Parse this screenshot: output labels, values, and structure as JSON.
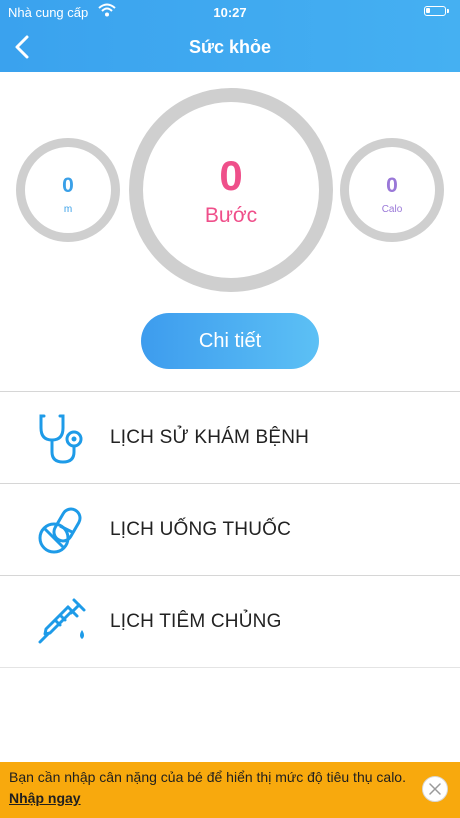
{
  "status_bar": {
    "carrier": "Nhà cung cấp",
    "time": "10:27"
  },
  "header": {
    "title": "Sức khỏe",
    "back_icon": "chevron-left-icon"
  },
  "stats": {
    "distance": {
      "value": "0",
      "unit": "m",
      "color": "#3aa0e8"
    },
    "steps": {
      "value": "0",
      "unit": "Bước",
      "color": "#ef4f8a"
    },
    "calories": {
      "value": "0",
      "unit": "Calo",
      "color": "#9a78d8"
    }
  },
  "detail_button": {
    "label": "Chi tiết"
  },
  "menu": {
    "items": [
      {
        "label": "LỊCH SỬ KHÁM BỆNH",
        "icon": "stethoscope-icon"
      },
      {
        "label": "LỊCH UỐNG THUỐC",
        "icon": "pill-icon"
      },
      {
        "label": "LỊCH TIÊM CHỦNG",
        "icon": "syringe-icon"
      }
    ]
  },
  "banner": {
    "message": "Bạn cần nhập cân nặng của bé để hiển thị mức độ tiêu thụ calo.",
    "link": "Nhập ngay",
    "close_icon": "close-icon"
  },
  "colors": {
    "header": "#3aa2ee",
    "banner": "#f8a90d",
    "icon": "#1e9be8"
  }
}
